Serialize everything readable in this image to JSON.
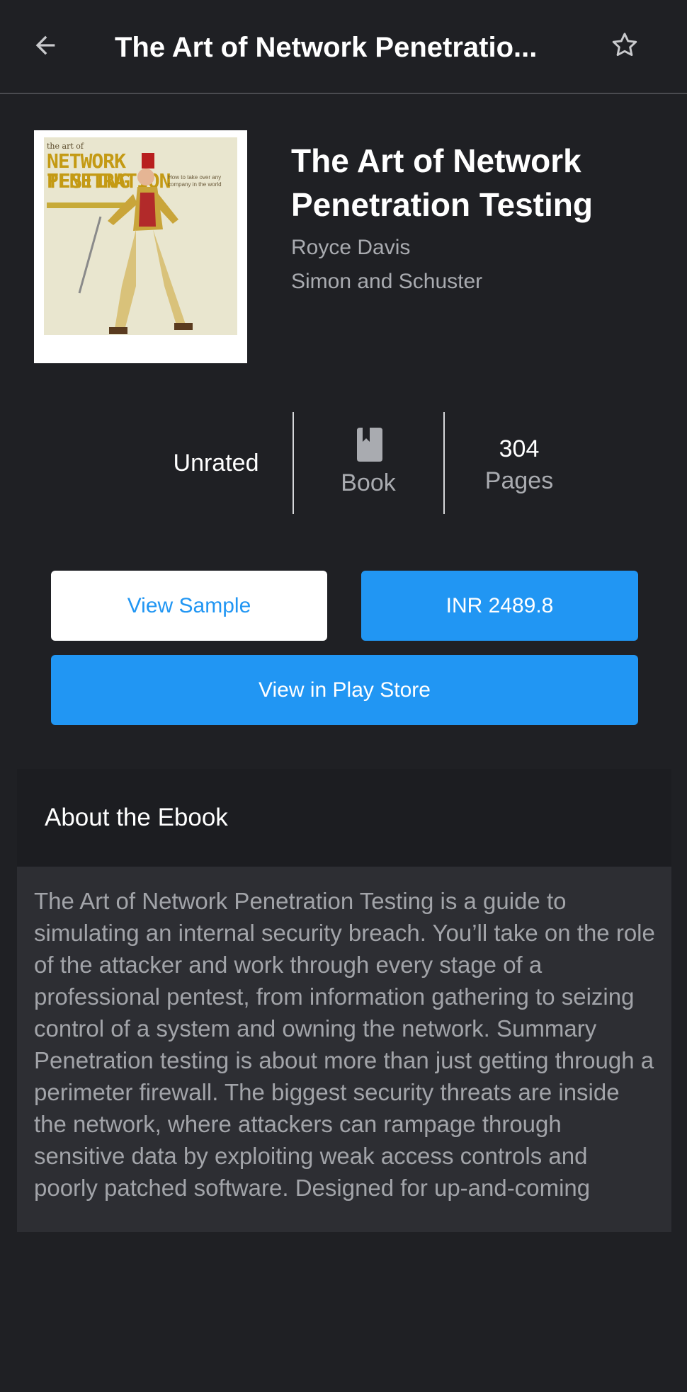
{
  "topbar": {
    "title": "The Art of Network Penetratio...",
    "back_icon": "arrow-left-icon",
    "favorite_icon": "star-outline-icon"
  },
  "book": {
    "title": "The Art of Network Penetration Testing",
    "author": "Royce Davis",
    "publisher": "Simon and Schuster",
    "cover": {
      "line1": "the art of",
      "line2": "NETWORK PENETRATION",
      "line3": "TESTING",
      "tagline": "How to take over any company in the world"
    }
  },
  "stats": {
    "rating": "Unrated",
    "type_icon": "book-icon",
    "type": "Book",
    "pages_count": "304",
    "pages_label": "Pages"
  },
  "actions": {
    "sample": "View Sample",
    "price": "INR 2489.8",
    "store": "View in Play Store"
  },
  "about": {
    "title": "About the Ebook",
    "text": "The Art of Network Penetration Testing is a guide to simulating an internal security breach. You’ll take on the role of the attacker and work through every stage of a professional pentest, from information gathering to seizing control of a system and owning the network. Summary Penetration testing is about more than just getting through a perimeter firewall. The biggest security threats are inside the network, where attackers can rampage through sensitive data by exploiting weak access controls and poorly patched software. Designed for up-and-coming"
  },
  "colors": {
    "background": "#1f2024",
    "accent": "#2196f3",
    "muted_text": "#a9abb0",
    "card": "#2d2e33"
  }
}
